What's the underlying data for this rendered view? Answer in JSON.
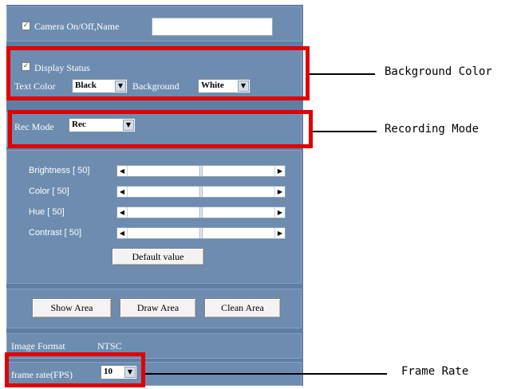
{
  "camera": {
    "checked": true,
    "label": "Camera On/Off,Name",
    "name_value": ""
  },
  "display": {
    "checked": true,
    "status_label": "Display Status",
    "text_color_label": "Text Color",
    "text_color_value": "Black",
    "background_label": "Background",
    "background_value": "White"
  },
  "rec": {
    "label": "Rec Mode",
    "value": "Rec"
  },
  "adjust": {
    "sliders": [
      {
        "label": "Brightness [ 50]",
        "value": 50
      },
      {
        "label": "Color [ 50]",
        "value": 50
      },
      {
        "label": "Hue [ 50]",
        "value": 50
      },
      {
        "label": "Contrast [ 50]",
        "value": 50
      }
    ],
    "default_button": "Default value"
  },
  "area": {
    "show": "Show Area",
    "draw": "Draw Area",
    "clean": "Clean Area"
  },
  "format": {
    "label": "Image Format",
    "value": "NTSC"
  },
  "fps": {
    "label": "frame rate(FPS)",
    "value": "10"
  },
  "callouts": {
    "background_color": "Background Color",
    "recording_mode": "Recording Mode",
    "frame_rate": "Frame Rate"
  },
  "colors": {
    "panel": "#5f7ea3",
    "section": "#6d8cb0",
    "highlight": "#e00000"
  }
}
